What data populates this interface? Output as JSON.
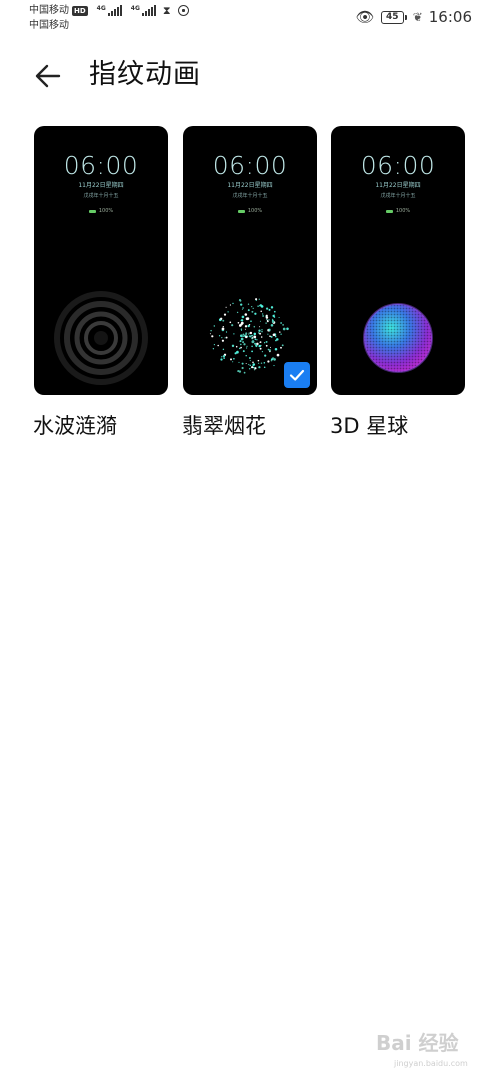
{
  "status_bar": {
    "carrier1": "中国移动",
    "carrier2": "中国移动",
    "hd": "HD",
    "network1": "4G",
    "network2": "4G",
    "battery": "45",
    "time": "16:06",
    "icons": [
      "hourglass-icon",
      "circle-status-icon",
      "eye-icon",
      "battery-icon",
      "leaf-icon"
    ]
  },
  "header": {
    "back_icon": "arrow-left-icon",
    "title": "指纹动画"
  },
  "lockscreen_preview": {
    "time": "06:00",
    "date": "11月22日星期四",
    "lunar": "戊戌年十月十五",
    "battery": "100%"
  },
  "options": [
    {
      "label": "水波涟漪",
      "animation": "ripple",
      "selected": false
    },
    {
      "label": "翡翠烟花",
      "animation": "fireworks",
      "selected": true
    },
    {
      "label": "3D 星球",
      "animation": "planet",
      "selected": false
    }
  ],
  "watermark": {
    "text": "Bai 经验",
    "sub": "jingyan.baidu.com"
  },
  "colors": {
    "accent": "#1a7ef2",
    "card_bg": "#000000",
    "clock": "#bfe7e7"
  }
}
